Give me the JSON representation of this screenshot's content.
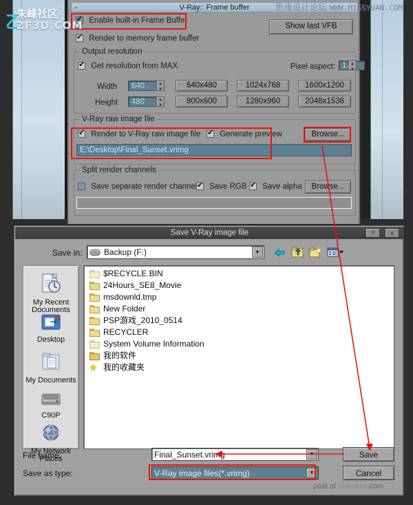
{
  "vray_panel": {
    "title": "V-Ray:: Frame buffer",
    "collapse_glyph": "-",
    "enable_fb_label": "Enable built-in Frame Buffer",
    "render_mem_label": "Render to memory frame buffer",
    "show_last_vfb_label": "Show last VFB",
    "output_resolution": {
      "group_title": "Output resolution",
      "get_from_max_label": "Get resolution from MAX",
      "pixel_aspect_label": "Pixel aspect:",
      "pixel_aspect_value": "1.0",
      "width_label": "Width",
      "width_value": "640",
      "height_label": "Height",
      "height_value": "480",
      "presets": [
        "640x480",
        "1024x768",
        "1600x1200",
        "800x600",
        "1280x960",
        "2048x1536"
      ]
    },
    "raw_image": {
      "group_title": "V-Ray raw image file",
      "render_raw_label": "Render to V-Ray raw image file",
      "generate_preview_label": "Generate preview",
      "browse_label": "Browse...",
      "path_value": "E:\\Desktop\\Final_Sunset.vrimg"
    },
    "split_channels": {
      "group_title": "Split render channels",
      "save_separate_label": "Save separate render channels",
      "save_rgb_label": "Save RGB",
      "save_alpha_label": "Save alpha",
      "browse_label": "Browse...",
      "path_value": ""
    }
  },
  "save_dialog": {
    "title": "Save V-Ray image file",
    "help_btn": "?",
    "close_btn": "x",
    "save_in_label": "Save in:",
    "save_in_value": "Backup (F:)",
    "toolbar": {
      "back": "back-arrow",
      "up": "up-one-level",
      "new_folder": "create-new-folder",
      "views": "views-menu"
    },
    "places": [
      {
        "label": "My Recent Documents",
        "icon": "recent-documents-icon"
      },
      {
        "label": "Desktop",
        "icon": "desktop-icon"
      },
      {
        "label": "My Documents",
        "icon": "my-documents-icon"
      },
      {
        "label": "C90P",
        "icon": "hard-drive-icon"
      },
      {
        "label": "My Network Places",
        "icon": "network-places-icon"
      }
    ],
    "files": [
      {
        "name": "$RECYCLE.BIN",
        "icon": "folder-pale"
      },
      {
        "name": "24Hours_SE8_Movie",
        "icon": "folder"
      },
      {
        "name": "msdownld.tmp",
        "icon": "folder"
      },
      {
        "name": "New Folder",
        "icon": "folder"
      },
      {
        "name": "PSP游戏_2010_0514",
        "icon": "folder"
      },
      {
        "name": "RECYCLER",
        "icon": "folder"
      },
      {
        "name": "System Volume Information",
        "icon": "folder-pale"
      },
      {
        "name": "我的软件",
        "icon": "folder-open"
      },
      {
        "name": "我的收藏夹",
        "icon": "star"
      }
    ],
    "file_name_label": "File name:",
    "file_name_value": "Final_Sunset.vrimg",
    "save_as_type_label": "Save as type:",
    "save_as_type_value": "V-Ray image files(*.vrimg)",
    "save_button": "Save",
    "cancel_button": "Cancel"
  },
  "watermarks": {
    "missyuan_cn": "思缘设计论坛",
    "missyuan_en": "WWW.MISSYUAN.COM",
    "zf_cn": "朱峰社区",
    "zf_en": "ZF3D.COM",
    "uimaker_prefix": "post of ",
    "uimaker_name": "uimaker",
    "uimaker_suffix": ".com"
  },
  "colors": {
    "highlight": "#e8140c",
    "panel": "#9a9a9a",
    "field_teal": "#5e7f92",
    "dialog": "#a0a0a0"
  }
}
